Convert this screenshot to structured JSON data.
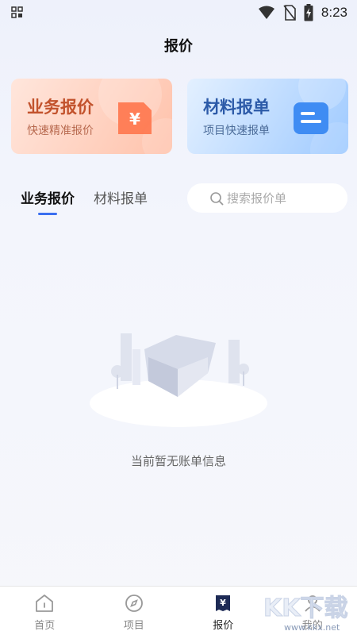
{
  "status_bar": {
    "time": "8:23"
  },
  "header": {
    "title": "报价"
  },
  "cards": [
    {
      "title": "业务报价",
      "subtitle": "快速精准报价"
    },
    {
      "title": "材料报单",
      "subtitle": "项目快速报单"
    }
  ],
  "tabs": [
    {
      "label": "业务报价",
      "active": true
    },
    {
      "label": "材料报单",
      "active": false
    }
  ],
  "search": {
    "placeholder": "搜索报价单"
  },
  "empty_state": {
    "message": "当前暂无账单信息"
  },
  "bottom_nav": [
    {
      "label": "首页",
      "icon": "home-icon"
    },
    {
      "label": "项目",
      "icon": "compass-icon"
    },
    {
      "label": "报价",
      "icon": "quote-icon",
      "active": true
    },
    {
      "label": "我的",
      "icon": "profile-icon"
    }
  ],
  "watermark": {
    "text": "KK下载",
    "url": "www.kkx.net"
  },
  "colors": {
    "accent": "#3a6ff0",
    "quote_card": "#ff8a65",
    "material_card": "#4a90f0"
  }
}
